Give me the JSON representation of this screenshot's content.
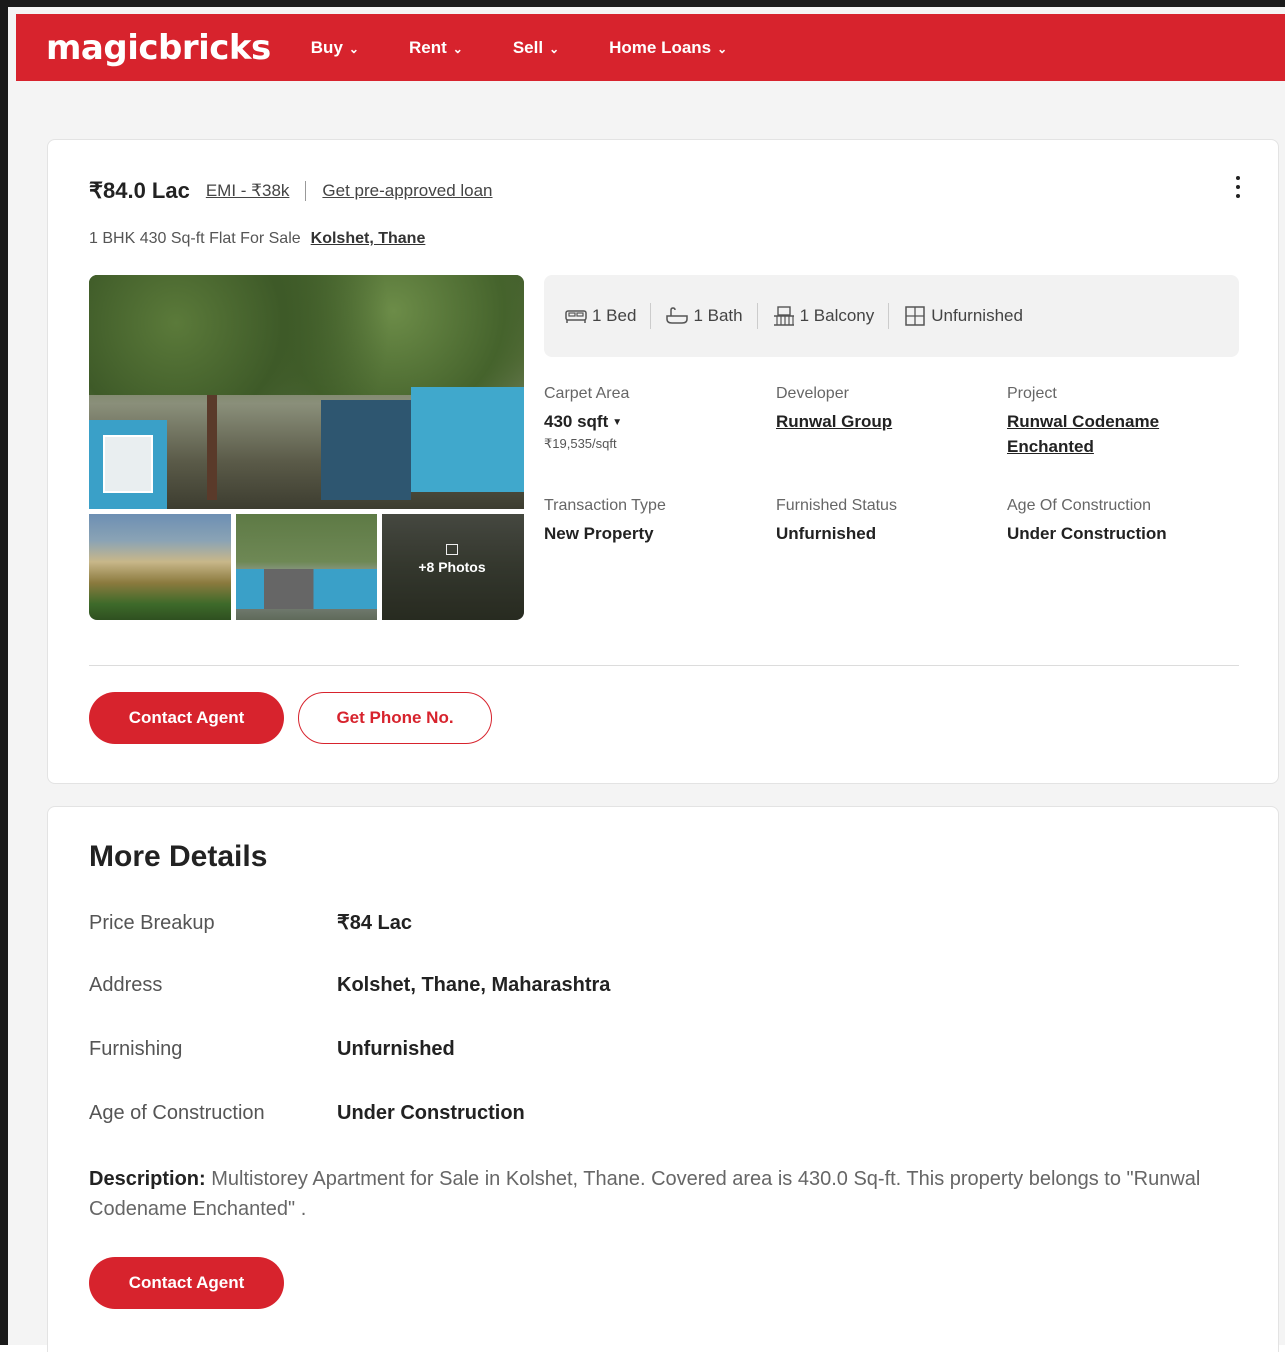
{
  "header": {
    "logo": "magicbricks",
    "nav": [
      {
        "label": "Buy"
      },
      {
        "label": "Rent"
      },
      {
        "label": "Sell"
      },
      {
        "label": "Home Loans"
      }
    ],
    "brand_color": "#d7232d"
  },
  "listing": {
    "price": "₹84.0 Lac",
    "emi": "EMI - ₹38k",
    "loan_link": "Get pre-approved loan",
    "subtitle": "1 BHK 430 Sq-ft Flat For Sale",
    "locality": "Kolshet, Thane",
    "photos_more": "+8 Photos",
    "amenities": [
      {
        "label": "1 Bed",
        "icon": "bed-icon"
      },
      {
        "label": "1 Bath",
        "icon": "bath-icon"
      },
      {
        "label": "1 Balcony",
        "icon": "balcony-icon"
      },
      {
        "label": "Unfurnished",
        "icon": "furnishing-icon"
      }
    ],
    "facts": {
      "carpet_area": {
        "label": "Carpet Area",
        "value": "430 sqft",
        "sub": "₹19,535/sqft"
      },
      "developer": {
        "label": "Developer",
        "value": "Runwal Group"
      },
      "project": {
        "label": "Project",
        "value": "Runwal Codename Enchanted"
      },
      "transaction": {
        "label": "Transaction Type",
        "value": "New Property"
      },
      "furnished": {
        "label": "Furnished Status",
        "value": "Unfurnished"
      },
      "age": {
        "label": "Age Of Construction",
        "value": "Under Construction"
      }
    },
    "contact_label": "Contact Agent",
    "phone_label": "Get Phone No."
  },
  "more_details": {
    "title": "More Details",
    "rows": [
      {
        "label": "Price Breakup",
        "value": "₹84 Lac"
      },
      {
        "label": "Address",
        "value": "Kolshet, Thane, Maharashtra"
      },
      {
        "label": "Furnishing",
        "value": "Unfurnished"
      },
      {
        "label": "Age of Construction",
        "value": "Under Construction"
      }
    ],
    "description_label": "Description:",
    "description": " Multistorey Apartment for Sale in Kolshet, Thane. Covered area is 430.0 Sq-ft. This property belongs to \"Runwal Codename Enchanted\" .",
    "contact_label": "Contact Agent"
  }
}
